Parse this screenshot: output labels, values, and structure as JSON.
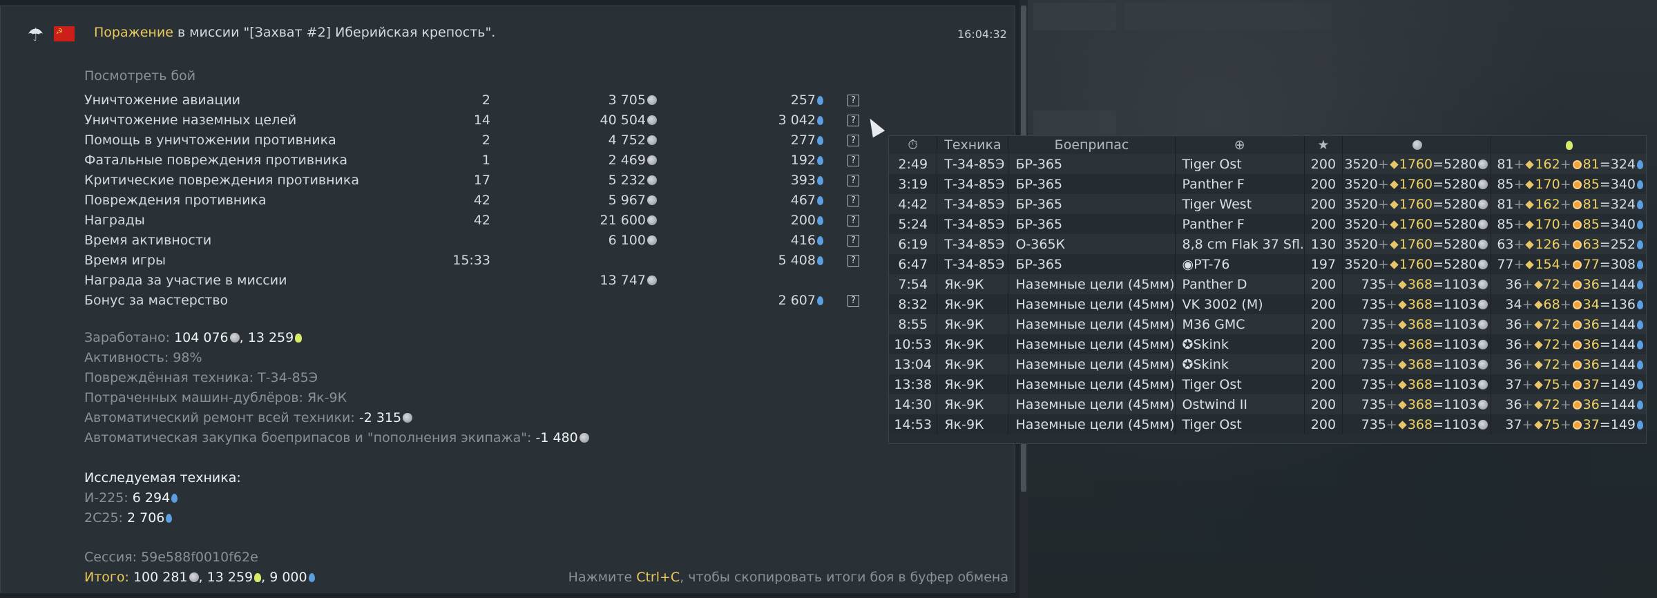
{
  "header": {
    "result_word": "Поражение",
    "mission_text": "в миссии \"[Захват #2] Иберийская крепость\".",
    "time": "16:04:32"
  },
  "view_battle": "Посмотреть бой",
  "rows": [
    {
      "label": "Уничтожение авиации",
      "count": "2",
      "sl": "3 705",
      "rp": "257",
      "help": "?"
    },
    {
      "label": "Уничтожение наземных целей",
      "count": "14",
      "sl": "40 504",
      "rp": "3 042",
      "help": "?"
    },
    {
      "label": "Помощь в уничтожении противника",
      "count": "2",
      "sl": "4 752",
      "rp": "277",
      "help": "?"
    },
    {
      "label": "Фатальные повреждения противника",
      "count": "1",
      "sl": "2 469",
      "rp": "192",
      "help": "?"
    },
    {
      "label": "Критические повреждения противника",
      "count": "17",
      "sl": "5 232",
      "rp": "393",
      "help": "?"
    },
    {
      "label": "Повреждения противника",
      "count": "42",
      "sl": "5 967",
      "rp": "467",
      "help": "?"
    },
    {
      "label": "Награды",
      "count": "42",
      "sl": "21 600",
      "rp": "200",
      "help": "?"
    },
    {
      "label": "Время активности",
      "count": "",
      "sl": "6 100",
      "rp": "416",
      "help": "?"
    },
    {
      "label": "Время игры",
      "count": "15:33",
      "sl": "",
      "rp": "5 408",
      "help": "?"
    },
    {
      "label": "Награда за участие в миссии",
      "count": "",
      "sl": "13 747",
      "rp": "",
      "help": ""
    },
    {
      "label": "Бонус за мастерство",
      "count": "",
      "sl": "",
      "rp": "2 607",
      "help": "?"
    }
  ],
  "summary": {
    "earned_label": "Заработано:",
    "earned_sl": "104 076",
    "earned_rp": "13 259",
    "activity": "Активность: 98%",
    "damaged": "Повреждённая техника: Т-34-85Э",
    "spent": "Потраченных машин-дублёров: Як-9К",
    "repair_label": "Автоматический ремонт всей техники:",
    "repair_value": "-2 315",
    "ammo_label": "Автоматическая закупка боеприпасов и \"пополнения экипажа\":",
    "ammo_value": "-1 480"
  },
  "research": {
    "title": "Исследуемая техника:",
    "items": [
      {
        "name": "И-225:",
        "value": "6 294"
      },
      {
        "name": "2С25:",
        "value": "2 706"
      }
    ]
  },
  "session": "Сессия: 59e588f0010f62e",
  "total": {
    "label": "Итого:",
    "sl": "100 281",
    "rp1": "13 259",
    "rp2": "9 000"
  },
  "hint": {
    "before": "Нажмите ",
    "key": "Ctrl+C",
    "after": ", чтобы скопировать итоги боя в буфер обмена"
  },
  "popup": {
    "headers": {
      "time_icon": "clock-icon",
      "vehicle": "Техника",
      "ammo": "Боеприпас",
      "target_icon": "crosshair-icon",
      "star": "★",
      "sl_icon": "silver-lion-icon",
      "rp_icon": "research-icon"
    },
    "rows": [
      {
        "time": "2:49",
        "vehicle": "Т-34-85Э",
        "ammo": "БР-365",
        "target": "Tiger Ost",
        "mark": "",
        "score": "200",
        "sl_a": "3520",
        "sl_b": "1760",
        "sl_c": "5280",
        "rp_a": "81",
        "rp_b": "162",
        "rp_c": "81",
        "rp_d": "324"
      },
      {
        "time": "3:19",
        "vehicle": "Т-34-85Э",
        "ammo": "БР-365",
        "target": "Panther F",
        "mark": "",
        "score": "200",
        "sl_a": "3520",
        "sl_b": "1760",
        "sl_c": "5280",
        "rp_a": "85",
        "rp_b": "170",
        "rp_c": "85",
        "rp_d": "340"
      },
      {
        "time": "4:42",
        "vehicle": "Т-34-85Э",
        "ammo": "БР-365",
        "target": "Tiger West",
        "mark": "",
        "score": "200",
        "sl_a": "3520",
        "sl_b": "1760",
        "sl_c": "5280",
        "rp_a": "81",
        "rp_b": "162",
        "rp_c": "81",
        "rp_d": "324"
      },
      {
        "time": "5:24",
        "vehicle": "Т-34-85Э",
        "ammo": "БР-365",
        "target": "Panther F",
        "mark": "",
        "score": "200",
        "sl_a": "3520",
        "sl_b": "1760",
        "sl_c": "5280",
        "rp_a": "85",
        "rp_b": "170",
        "rp_c": "85",
        "rp_d": "340"
      },
      {
        "time": "6:19",
        "vehicle": "Т-34-85Э",
        "ammo": "О-365К",
        "target": "8,8 cm Flak 37 Sfl.",
        "mark": "",
        "score": "130",
        "sl_a": "3520",
        "sl_b": "1760",
        "sl_c": "5280",
        "rp_a": "63",
        "rp_b": "126",
        "rp_c": "63",
        "rp_d": "252"
      },
      {
        "time": "6:47",
        "vehicle": "Т-34-85Э",
        "ammo": "БР-365",
        "target": "PT-76",
        "mark": "◉",
        "score": "197",
        "sl_a": "3520",
        "sl_b": "1760",
        "sl_c": "5280",
        "rp_a": "77",
        "rp_b": "154",
        "rp_c": "77",
        "rp_d": "308"
      },
      {
        "time": "7:54",
        "vehicle": "Як-9К",
        "ammo": "Наземные цели (45мм)",
        "target": "Panther D",
        "mark": "",
        "score": "200",
        "sl_a": "735",
        "sl_b": "368",
        "sl_c": "1103",
        "rp_a": "36",
        "rp_b": "72",
        "rp_c": "36",
        "rp_d": "144"
      },
      {
        "time": "8:32",
        "vehicle": "Як-9К",
        "ammo": "Наземные цели (45мм)",
        "target": "VK 3002 (M)",
        "mark": "",
        "score": "200",
        "sl_a": "735",
        "sl_b": "368",
        "sl_c": "1103",
        "rp_a": "34",
        "rp_b": "68",
        "rp_c": "34",
        "rp_d": "136"
      },
      {
        "time": "8:55",
        "vehicle": "Як-9К",
        "ammo": "Наземные цели (45мм)",
        "target": "M36 GMC",
        "mark": "",
        "score": "200",
        "sl_a": "735",
        "sl_b": "368",
        "sl_c": "1103",
        "rp_a": "36",
        "rp_b": "72",
        "rp_c": "36",
        "rp_d": "144"
      },
      {
        "time": "10:53",
        "vehicle": "Як-9К",
        "ammo": "Наземные цели (45мм)",
        "target": "Skink",
        "mark": "✪",
        "score": "200",
        "sl_a": "735",
        "sl_b": "368",
        "sl_c": "1103",
        "rp_a": "36",
        "rp_b": "72",
        "rp_c": "36",
        "rp_d": "144"
      },
      {
        "time": "13:04",
        "vehicle": "Як-9К",
        "ammo": "Наземные цели (45мм)",
        "target": "Skink",
        "mark": "✪",
        "score": "200",
        "sl_a": "735",
        "sl_b": "368",
        "sl_c": "1103",
        "rp_a": "36",
        "rp_b": "72",
        "rp_c": "36",
        "rp_d": "144"
      },
      {
        "time": "13:38",
        "vehicle": "Як-9К",
        "ammo": "Наземные цели (45мм)",
        "target": "Tiger Ost",
        "mark": "",
        "score": "200",
        "sl_a": "735",
        "sl_b": "368",
        "sl_c": "1103",
        "rp_a": "37",
        "rp_b": "75",
        "rp_c": "37",
        "rp_d": "149"
      },
      {
        "time": "14:30",
        "vehicle": "Як-9К",
        "ammo": "Наземные цели (45мм)",
        "target": "Ostwind II",
        "mark": "",
        "score": "200",
        "sl_a": "735",
        "sl_b": "368",
        "sl_c": "1103",
        "rp_a": "36",
        "rp_b": "72",
        "rp_c": "36",
        "rp_d": "144"
      },
      {
        "time": "14:53",
        "vehicle": "Як-9К",
        "ammo": "Наземные цели (45мм)",
        "target": "Tiger Ost",
        "mark": "",
        "score": "200",
        "sl_a": "735",
        "sl_b": "368",
        "sl_c": "1103",
        "rp_a": "37",
        "rp_b": "75",
        "rp_c": "37",
        "rp_d": "149"
      }
    ]
  }
}
